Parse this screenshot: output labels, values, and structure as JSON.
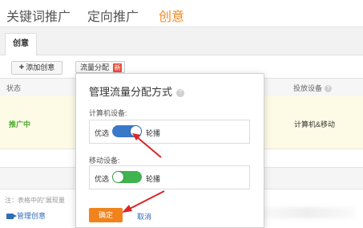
{
  "top_tabs": [
    {
      "label": "关键词推广",
      "active": false
    },
    {
      "label": "定向推广",
      "active": false
    },
    {
      "label": "创意",
      "active": true
    }
  ],
  "sub_tab": {
    "label": "创意"
  },
  "toolbar": {
    "add_label": "添加创意",
    "flow_label": "流量分配",
    "flow_badge": "新"
  },
  "table": {
    "headers": {
      "status": "状态",
      "device": "投放设备"
    },
    "row": {
      "status": "推广中",
      "device": "计算机&移动"
    }
  },
  "footer": {
    "note": "注：表格中的\"展现量",
    "manage_label": "管理创意"
  },
  "popup": {
    "title": "管理流量分配方式",
    "pc": {
      "label": "计算机设备:",
      "left_option": "优选",
      "right_option": "轮播",
      "selected": "轮播"
    },
    "mobile": {
      "label": "移动设备:",
      "left_option": "优选",
      "right_option": "轮播",
      "selected": "优选"
    },
    "ok_label": "确定",
    "cancel_label": "取消"
  },
  "colors": {
    "accent": "#f08a24",
    "toggle_pc": "#3a78c9",
    "toggle_mobile": "#3fb34f",
    "status_green": "#4caa2f",
    "link_blue": "#2f6db5",
    "arrow_red": "#d9262a"
  }
}
